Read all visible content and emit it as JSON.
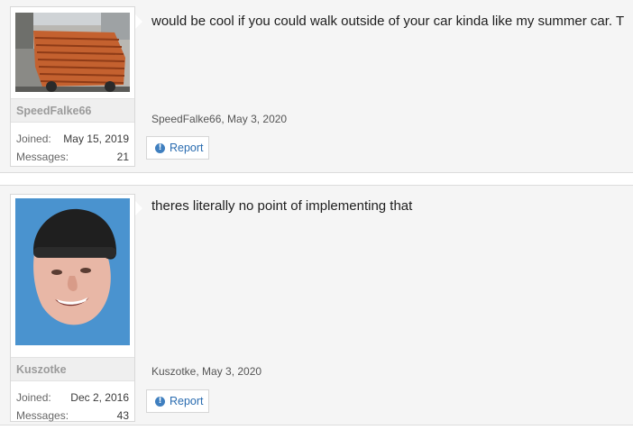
{
  "posts": [
    {
      "username": "SpeedFalke66",
      "avatar_icon": "car-with-bricks-photo",
      "joined_label": "Joined:",
      "joined_value": "May 15, 2019",
      "messages_label": "Messages:",
      "messages_value": "21",
      "message": "would be cool if you could walk outside of your car kinda like my summer car. T",
      "meta": "SpeedFalke66, May 3, 2020",
      "report_label": "Report"
    },
    {
      "username": "Kuszotke",
      "avatar_icon": "man-in-beanie-photo",
      "joined_label": "Joined:",
      "joined_value": "Dec 2, 2016",
      "messages_label": "Messages:",
      "messages_value": "43",
      "message": "theres literally no point of implementing that",
      "meta": "Kuszotke, May 3, 2020",
      "report_label": "Report"
    }
  ],
  "colors": {
    "accent": "#2a6cb0",
    "avatar_bg_blue": "#4a93cf",
    "post_bg": "#f5f5f5"
  }
}
